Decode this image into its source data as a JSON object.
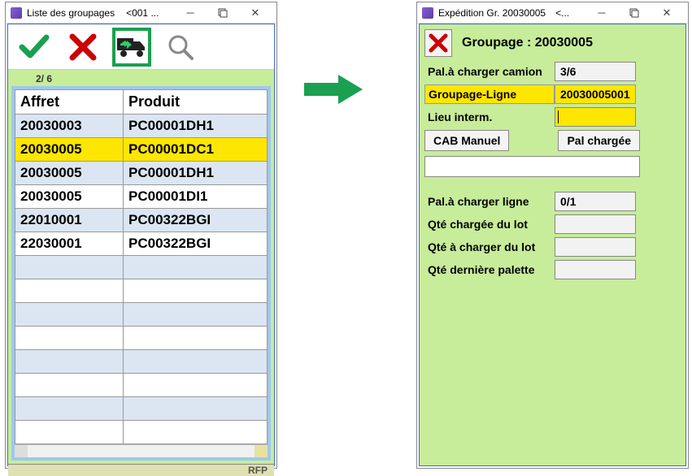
{
  "left": {
    "title": "Liste des groupages",
    "title_extra": "<001 ...",
    "counter": "2/   6",
    "columns": [
      "Affret",
      "Produit"
    ],
    "rows": [
      {
        "affret": "20030003",
        "produit": "PC00001DH1",
        "alt": true
      },
      {
        "affret": "20030005",
        "produit": "PC00001DC1",
        "sel": true
      },
      {
        "affret": "20030005",
        "produit": "PC00001DH1",
        "alt": true
      },
      {
        "affret": "20030005",
        "produit": "PC00001DI1"
      },
      {
        "affret": "22010001",
        "produit": "PC00322BGI",
        "alt": true
      },
      {
        "affret": "22030001",
        "produit": "PC00322BGI"
      }
    ],
    "status": "RFP"
  },
  "right": {
    "title": "Expédition Gr. 20030005",
    "title_extra": "<...",
    "header": "Groupage : 20030005",
    "pal_camion_label": "Pal.à charger camion",
    "pal_camion_value": "3/6",
    "groupage_ligne_label": "Groupage-Ligne",
    "groupage_ligne_value": "20030005001",
    "lieu_interm_label": "Lieu interm.",
    "cab_manuel": "CAB Manuel",
    "pal_chargee": "Pal chargée",
    "pal_ligne_label": "Pal.à charger ligne",
    "pal_ligne_value": "0/1",
    "qte_chargee_label": "Qté chargée du lot",
    "qte_a_charger_label": "Qté à charger du lot",
    "qte_derniere_label": "Qté dernière palette"
  }
}
